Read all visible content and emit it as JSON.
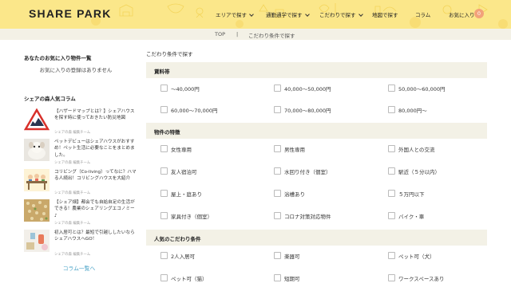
{
  "header": {
    "logo": "SHARE PARK",
    "nav": [
      {
        "label": "エリアで探す"
      },
      {
        "label": "通勤通学で探す"
      },
      {
        "label": "こだわりで探す"
      },
      {
        "label": "地図で探す"
      },
      {
        "label": "コラム"
      },
      {
        "label": "お気に入り"
      }
    ],
    "favorite_count": "0"
  },
  "breadcrumb": {
    "home": "TOP",
    "separator": "|",
    "current": "こだわり条件で探す"
  },
  "sidebar": {
    "favorites_heading": "あなたのお気に入り物件一覧",
    "favorites_empty": "お気に入りの登録はありません",
    "columns_heading": "シェアの森人気コラム",
    "columns": [
      {
        "title": "【ハザードマップとは？】シェアハウスを探す時に使っておきたい防災地図",
        "meta": "シェアの森 編集チーム",
        "thumb": "hazard"
      },
      {
        "title": "ペットデビューはシェアハウスがおすすめ！ペット生活に必要なことをまとめました。",
        "meta": "シェアの森 編集チーム",
        "thumb": "pet"
      },
      {
        "title": "コリビング（Co-living）ってなに？ハマる人続出！コリビングハウスを大紹介",
        "meta": "シェアの森 編集チーム",
        "thumb": "coliving"
      },
      {
        "title": "【シェア畑】都会でも自給自足の生活ができる！農業のシェアリングエコノミー♪",
        "meta": "シェアの森 編集チーム",
        "thumb": "farm"
      },
      {
        "title": "初入居可とは？最短で引越ししたいならシェアハウスへGO！",
        "meta": "シェアの森 編集チーム",
        "thumb": "move"
      }
    ],
    "more_link": "コラム一覧へ"
  },
  "main": {
    "title": "こだわり条件で探す",
    "sections": [
      {
        "label": "賃料帯",
        "options": [
          "〜40,000円",
          "40,000〜50,000円",
          "50,000〜60,000円",
          "60,000〜70,000円",
          "70,000〜80,000円",
          "80,000円〜"
        ]
      },
      {
        "label": "物件の特徴",
        "options": [
          "女性専用",
          "男性専用",
          "外国人との交流",
          "友人宿泊可",
          "水回り付き（個室）",
          "駅近（５分以内）",
          "屋上・庭あり",
          "浴槽あり",
          "５万円以下",
          "家具付き（個室）",
          "コロナ対策対応物件",
          "バイク・車"
        ]
      },
      {
        "label": "人気のこだわり条件",
        "options": [
          "2人入居可",
          "楽器可",
          "ペット可（犬）",
          "ペット可（猫）",
          "短期可",
          "ワークスペースあり"
        ]
      }
    ]
  },
  "colors": {
    "header_bg": "#fbe78a",
    "section_bg": "#f3f1e6",
    "link": "#4aa3c7",
    "badge": "#f2a27a"
  }
}
